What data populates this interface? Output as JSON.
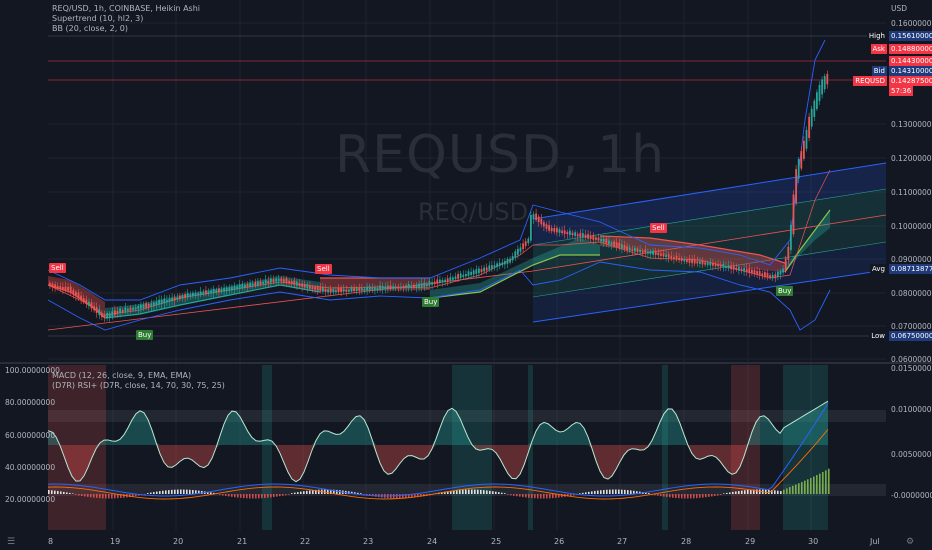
{
  "legend": {
    "symbol": "REQ/USD, 1h, COINBASE, Heikin Ashi",
    "supertrend": "Supertrend (10, hl2, 3)",
    "bb": "BB (20, close, 2, 0)",
    "macd": "MACD (12, 26, close, 9, EMA, EMA)",
    "rsi": "(D7R) RSI+ (D7R, close, 14, 70, 30, 75, 25)"
  },
  "watermark": {
    "title": "REQUSD, 1h",
    "subtitle": "REQ/USD"
  },
  "currency": "USD",
  "price_axis": [
    "0.16000000",
    "0.13000000",
    "0.12000000",
    "0.11000000",
    "0.10000000",
    "0.09000000",
    "0.08000000",
    "0.07000000",
    "0.06000000"
  ],
  "price_labels": [
    {
      "name": "High",
      "value": "0.15610000",
      "label_color": "#131722",
      "value_color": "#1e3a7b"
    },
    {
      "name": "Ask",
      "value": "0.14880000",
      "label_color": "#f23645",
      "value_color": "#f23645"
    },
    {
      "name": "",
      "value": "0.14430000",
      "label_color": "",
      "value_color": "#f23645"
    },
    {
      "name": "Bid",
      "value": "0.14310000",
      "label_color": "#1e3a7b",
      "value_color": "#1e3a7b"
    },
    {
      "name": "REQUSD",
      "value": "0.14287500",
      "label_color": "#f23645",
      "value_color": "#f23645"
    },
    {
      "name": "",
      "value": "57:36",
      "label_color": "",
      "value_color": "#f23645"
    },
    {
      "name": "Avg",
      "value": "0.08713877",
      "label_color": "#131722",
      "value_color": "#1e3a7b"
    },
    {
      "name": "Low",
      "value": "0.06750000",
      "label_color": "#131722",
      "value_color": "#1e3a7b"
    }
  ],
  "rsi_axis": [
    "100.00000000",
    "80.00000000",
    "60.00000000",
    "40.00000000",
    "20.00000000"
  ],
  "macd_axis": [
    "0.01500000",
    "0.01000000",
    "0.00500000",
    "-0.00000000"
  ],
  "time_axis": [
    "8",
    "19",
    "20",
    "21",
    "22",
    "23",
    "24",
    "25",
    "26",
    "27",
    "28",
    "29",
    "30",
    "Jul"
  ],
  "signals": [
    {
      "text": "Sell",
      "type": "sell"
    },
    {
      "text": "Buy",
      "type": "buy"
    },
    {
      "text": "Sell",
      "type": "sell"
    },
    {
      "text": "Buy",
      "type": "buy"
    },
    {
      "text": "Sell",
      "type": "sell"
    },
    {
      "text": "Buy",
      "type": "buy"
    }
  ],
  "colors": {
    "bg": "#131722",
    "up": "#26a69a",
    "down": "#ef5350",
    "buy": "#2e7d32",
    "sell": "#f23645",
    "bb": "#2962ff",
    "channel": "#2962ff"
  },
  "chart_data": {
    "type": "line",
    "title": "REQUSD, 1h",
    "style": "heikin-ashi candlestick",
    "ylim": [
      0.06,
      0.165
    ],
    "x": [
      "19",
      "20",
      "21",
      "22",
      "23",
      "24",
      "25",
      "26",
      "27",
      "28",
      "29",
      "30"
    ],
    "series": [
      {
        "values": [
          0.0745,
          0.0815,
          0.083,
          0.0835,
          0.0815,
          0.084,
          0.093,
          0.098,
          0.092,
          0.088,
          0.09,
          0.145
        ]
      }
    ]
  }
}
